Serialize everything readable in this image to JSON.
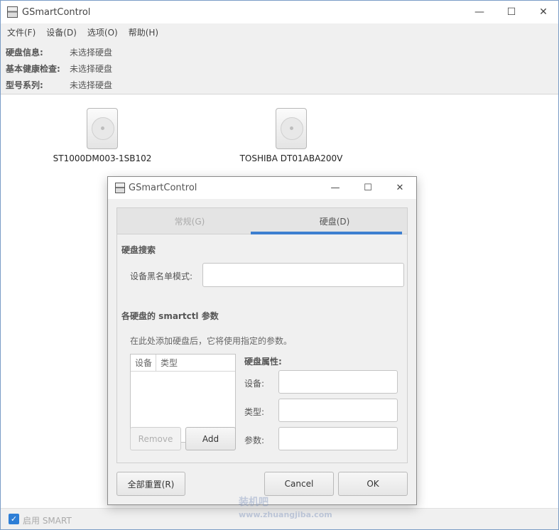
{
  "main_window": {
    "title": "GSmartControl",
    "controls": {
      "minimize": "—",
      "maximize": "☐",
      "close": "✕"
    }
  },
  "menubar": {
    "items": [
      {
        "label": "文件(F)"
      },
      {
        "label": "设备(D)"
      },
      {
        "label": "选项(O)"
      },
      {
        "label": "帮助(H)"
      }
    ]
  },
  "info_panel": {
    "rows": [
      {
        "label": "硬盘信息:",
        "value": "未选择硬盘"
      },
      {
        "label": "基本健康检查:",
        "value": "未选择硬盘"
      },
      {
        "label": "型号系列:",
        "value": "未选择硬盘"
      }
    ]
  },
  "drives": [
    {
      "name": "ST1000DM003-1SB102"
    },
    {
      "name": "TOSHIBA DT01ABA200V"
    }
  ],
  "statusbar": {
    "smart_label": "启用 SMART",
    "smart_checked": true
  },
  "watermark": {
    "line1": "装机吧",
    "line2": "www.zhuangjiba.com"
  },
  "dialog": {
    "title": "GSmartControl",
    "controls": {
      "minimize": "—",
      "maximize": "☐",
      "close": "✕"
    },
    "tabs": [
      {
        "label": "常规(G)",
        "active": false
      },
      {
        "label": "硬盘(D)",
        "active": true
      }
    ],
    "drive_search": {
      "title": "硬盘搜索",
      "blacklist_label": "设备黑名单模式:",
      "blacklist_value": ""
    },
    "smartctl": {
      "title": "各硬盘的 smartctl 参数",
      "hint": "在此处添加硬盘后，它将使用指定的参数。",
      "columns": [
        "设备",
        "类型"
      ],
      "rows": [],
      "remove_button": "Remove",
      "add_button": "Add",
      "props_title": "硬盘属性:",
      "device_label": "设备:",
      "device_value": "",
      "type_label": "类型:",
      "type_value": "",
      "params_label": "参数:",
      "params_value": ""
    },
    "buttons": {
      "reset_all": "全部重置(R)",
      "cancel": "Cancel",
      "ok": "OK"
    },
    "accent_color": "#3d7fd0"
  }
}
